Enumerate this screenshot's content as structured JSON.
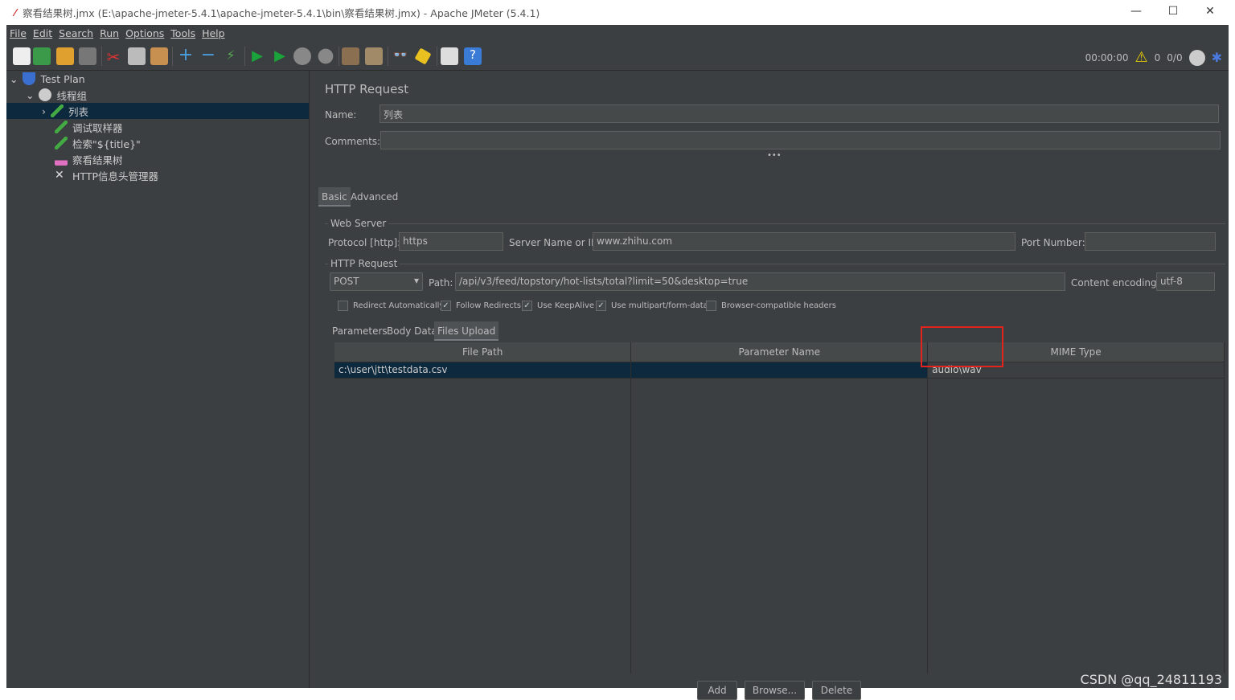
{
  "window": {
    "title": "察看结果树.jmx (E:\\apache-jmeter-5.4.1\\apache-jmeter-5.4.1\\bin\\察看结果树.jmx) - Apache JMeter (5.4.1)",
    "minimize": "—",
    "maximize": "☐",
    "close": "✕"
  },
  "menu": [
    "File",
    "Edit",
    "Search",
    "Run",
    "Options",
    "Tools",
    "Help"
  ],
  "toolbar": {
    "icons": [
      "new-icon",
      "templates-icon",
      "open-icon",
      "save-icon",
      "cut-icon",
      "copy-icon",
      "paste-icon",
      "expand-icon",
      "collapse-icon",
      "toggle-icon",
      "start-icon",
      "start-no-pause-icon",
      "stop-icon",
      "shutdown-icon",
      "clear-icon",
      "clear-all-icon",
      "search-icon",
      "reset-search-icon",
      "function-helper-icon",
      "help-icon"
    ],
    "timer": "00:00:00",
    "warnings": "0",
    "threads": "0/0"
  },
  "tree": [
    {
      "label": "Test Plan",
      "icon": "test-plan-icon",
      "level": 0,
      "expanded": true
    },
    {
      "label": "线程组",
      "icon": "thread-group-icon",
      "level": 1,
      "expanded": true
    },
    {
      "label": "列表",
      "icon": "sampler-icon",
      "level": 2,
      "selected": true,
      "collapsed": true
    },
    {
      "label": "调试取样器",
      "icon": "sampler-icon",
      "level": 2
    },
    {
      "label": "检索\"${title}\"",
      "icon": "sampler-icon",
      "level": 2
    },
    {
      "label": "察看结果树",
      "icon": "listener-icon",
      "level": 2
    },
    {
      "label": "HTTP信息头管理器",
      "icon": "config-icon",
      "level": 2
    }
  ],
  "panel": {
    "title": "HTTP Request",
    "name_label": "Name:",
    "name_value": "列表",
    "comments_label": "Comments:",
    "comments_value": "",
    "tabs": [
      "Basic",
      "Advanced"
    ],
    "web_server": {
      "legend": "Web Server",
      "protocol_label": "Protocol [http]:",
      "protocol": "https",
      "server_label": "Server Name or IP:",
      "server": "www.zhihu.com",
      "port_label": "Port Number:",
      "port": ""
    },
    "http_request": {
      "legend": "HTTP Request",
      "method": "POST",
      "path_label": "Path:",
      "path": "/api/v3/feed/topstory/hot-lists/total?limit=50&desktop=true",
      "encoding_label": "Content encoding:",
      "encoding": "utf-8"
    },
    "options": [
      {
        "label": "Redirect Automatically",
        "checked": false
      },
      {
        "label": "Follow Redirects",
        "checked": true
      },
      {
        "label": "Use KeepAlive",
        "checked": true
      },
      {
        "label": "Use multipart/form-data",
        "checked": true
      },
      {
        "label": "Browser-compatible headers",
        "checked": false
      }
    ],
    "subtabs": [
      "Parameters",
      "Body Data",
      "Files Upload"
    ],
    "active_subtab": "Files Upload",
    "table": {
      "headers": [
        "File Path",
        "Parameter Name",
        "MIME Type"
      ],
      "rows": [
        [
          "c:\\user\\jtt\\testdata.csv",
          "",
          "audio\\wav"
        ]
      ]
    },
    "buttons": {
      "add": "Add",
      "browse": "Browse...",
      "delete": "Delete"
    }
  },
  "watermark": "CSDN @qq_24811193",
  "colors": {
    "background": "#3c3f41",
    "selection": "#0d293e",
    "highlight": "#e4241c"
  }
}
